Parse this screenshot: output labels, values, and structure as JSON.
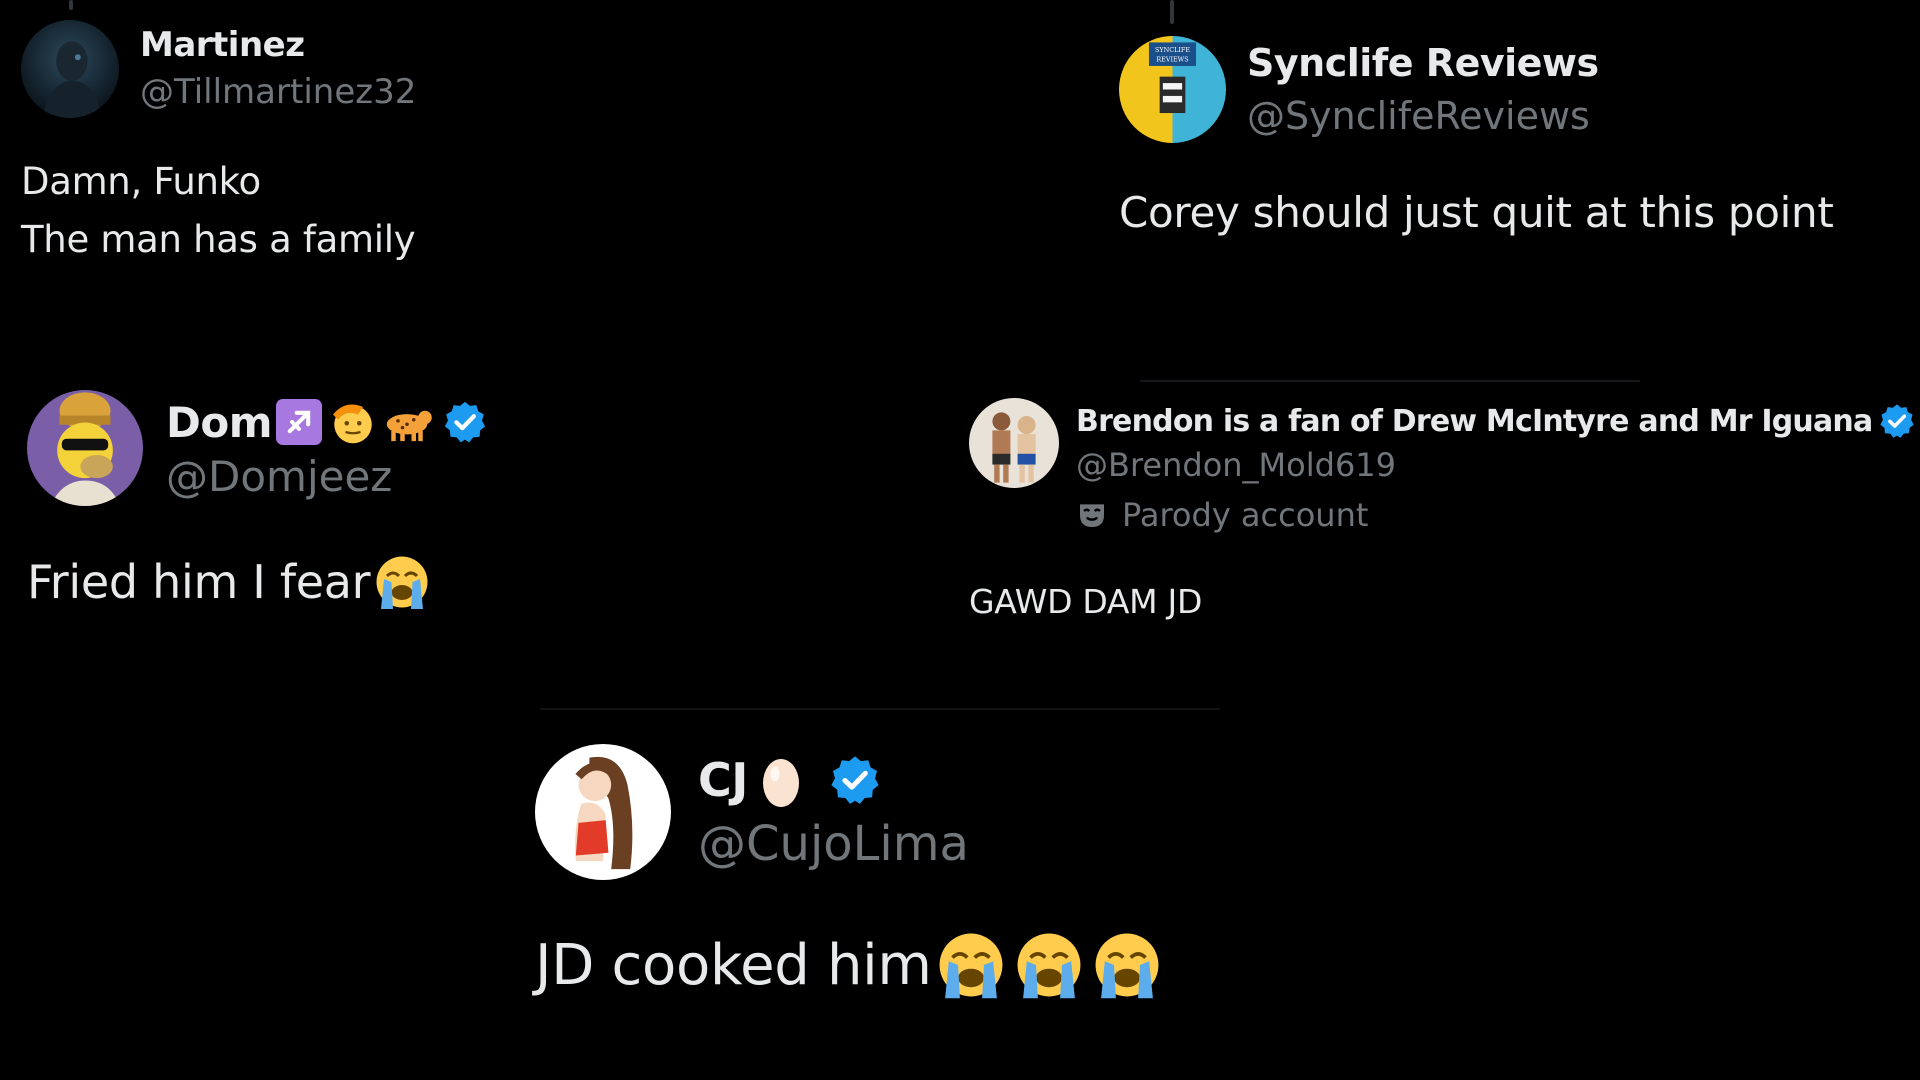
{
  "tweets": [
    {
      "id": "martinez",
      "name": "Martinez",
      "handle": "@Tillmartinez32",
      "text_lines": [
        "Damn, Funko",
        "The man has a family"
      ]
    },
    {
      "id": "synclife",
      "name": "Synclife Reviews",
      "handle": "@SynclifeReviews",
      "avatar_text": "SYNCLIFE REVIEWS",
      "text_lines": [
        "Corey should just quit at this point"
      ]
    },
    {
      "id": "dom",
      "name": "Dom",
      "handle": "@Domjeez",
      "name_emojis": [
        "sagittarius-icon",
        "saluting-face-icon",
        "leopard-icon"
      ],
      "verified": true,
      "text_lines": [
        "Fried him I fear"
      ],
      "text_emojis": [
        "loudly-crying-face-icon"
      ]
    },
    {
      "id": "brendon",
      "name": "Brendon is a fan of Drew McIntyre and Mr Iguana",
      "handle": "@Brendon_Mold619",
      "verified": true,
      "parody_label": "Parody account",
      "text_lines": [
        "GAWD DAM JD"
      ]
    },
    {
      "id": "cj",
      "name": "CJ",
      "handle": "@CujoLima",
      "name_emojis": [
        "egg-icon"
      ],
      "verified": true,
      "text_lines": [
        "JD cooked him"
      ],
      "text_emojis": [
        "loudly-crying-face-icon",
        "loudly-crying-face-icon",
        "loudly-crying-face-icon"
      ]
    }
  ],
  "colors": {
    "background": "#000000",
    "primary_text": "#e7e9ea",
    "secondary_text": "#71767b",
    "verified_blue": "#1d9bf0",
    "thread_line": "#333639"
  }
}
